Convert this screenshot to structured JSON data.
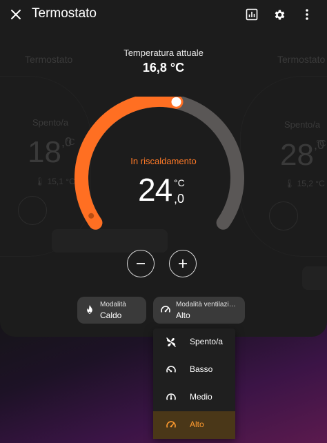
{
  "header": {
    "title": "Termostato",
    "close_icon": "close-icon",
    "history_icon": "chart-icon",
    "settings_icon": "gear-icon",
    "more_icon": "more-vertical-icon"
  },
  "background_cards": {
    "left": {
      "title": "Termostato",
      "state": "Spento/a",
      "target": "18",
      "decimal": ",0",
      "unit": "°C",
      "current": "15,1 °C"
    },
    "right": {
      "title": "Termostato",
      "state": "Spento/a",
      "target": "28",
      "decimal": ",0",
      "unit": "°C",
      "current": "15,2 °C"
    }
  },
  "current": {
    "label": "Temperatura attuale",
    "value": "16,8 °C"
  },
  "thermostat": {
    "state": "In riscaldamento",
    "target_int": "24",
    "target_decimal": ",0",
    "unit": "°C",
    "range_fraction": 0.55,
    "accent": "#ff6f22",
    "track": "#5a5756"
  },
  "controls": {
    "decrease_icon": "minus-icon",
    "increase_icon": "plus-icon"
  },
  "chips": {
    "mode": {
      "label": "Modalità",
      "value": "Caldo",
      "icon": "fire-icon"
    },
    "fan": {
      "label": "Modalità ventilazione",
      "value": "Alto",
      "icon": "speedometer-icon"
    }
  },
  "fan_menu": {
    "items": [
      {
        "label": "Spento/a",
        "icon": "fan-off-icon"
      },
      {
        "label": "Basso",
        "icon": "speed-low-icon"
      },
      {
        "label": "Medio",
        "icon": "speed-medium-icon"
      },
      {
        "label": "Alto",
        "icon": "speed-high-icon",
        "selected": true
      }
    ],
    "selected_color": "#ff9b2f"
  }
}
